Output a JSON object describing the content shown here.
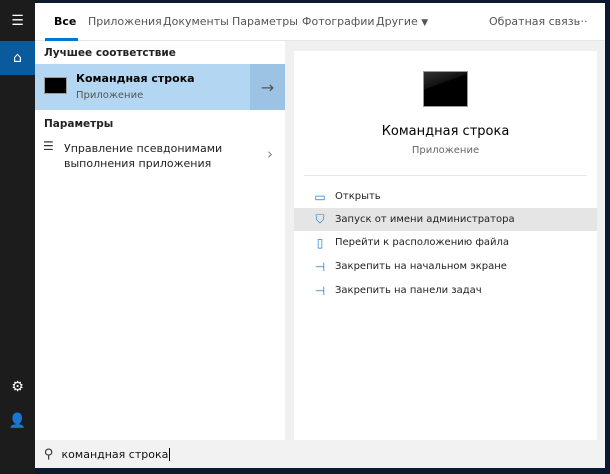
{
  "sidebar": {
    "icons": [
      "menu-icon",
      "home-icon",
      "gear-icon",
      "feedback-icon"
    ]
  },
  "header": {
    "tabs": [
      "Все",
      "Приложения",
      "Документы",
      "Параметры",
      "Фотографии",
      "Другие"
    ],
    "feedback": "Обратная связь",
    "more": "···"
  },
  "results": {
    "best_match_label": "Лучшее соответствие",
    "best": {
      "title": "Командная строка",
      "subtitle": "Приложение"
    },
    "settings_label": "Параметры",
    "setting_item": [
      "Управление псевдонимами",
      "выполнения приложения"
    ]
  },
  "preview": {
    "title": "Командная строка",
    "subtitle": "Приложение",
    "actions": [
      "Открыть",
      "Запуск от имени администратора",
      "Перейти к расположению файла",
      "Закрепить на начальном экране",
      "Закрепить на панели задач"
    ]
  },
  "search": {
    "value": "командная строка"
  },
  "colors": {
    "accent": "#0078d7",
    "selected": "#b3d7f2"
  }
}
